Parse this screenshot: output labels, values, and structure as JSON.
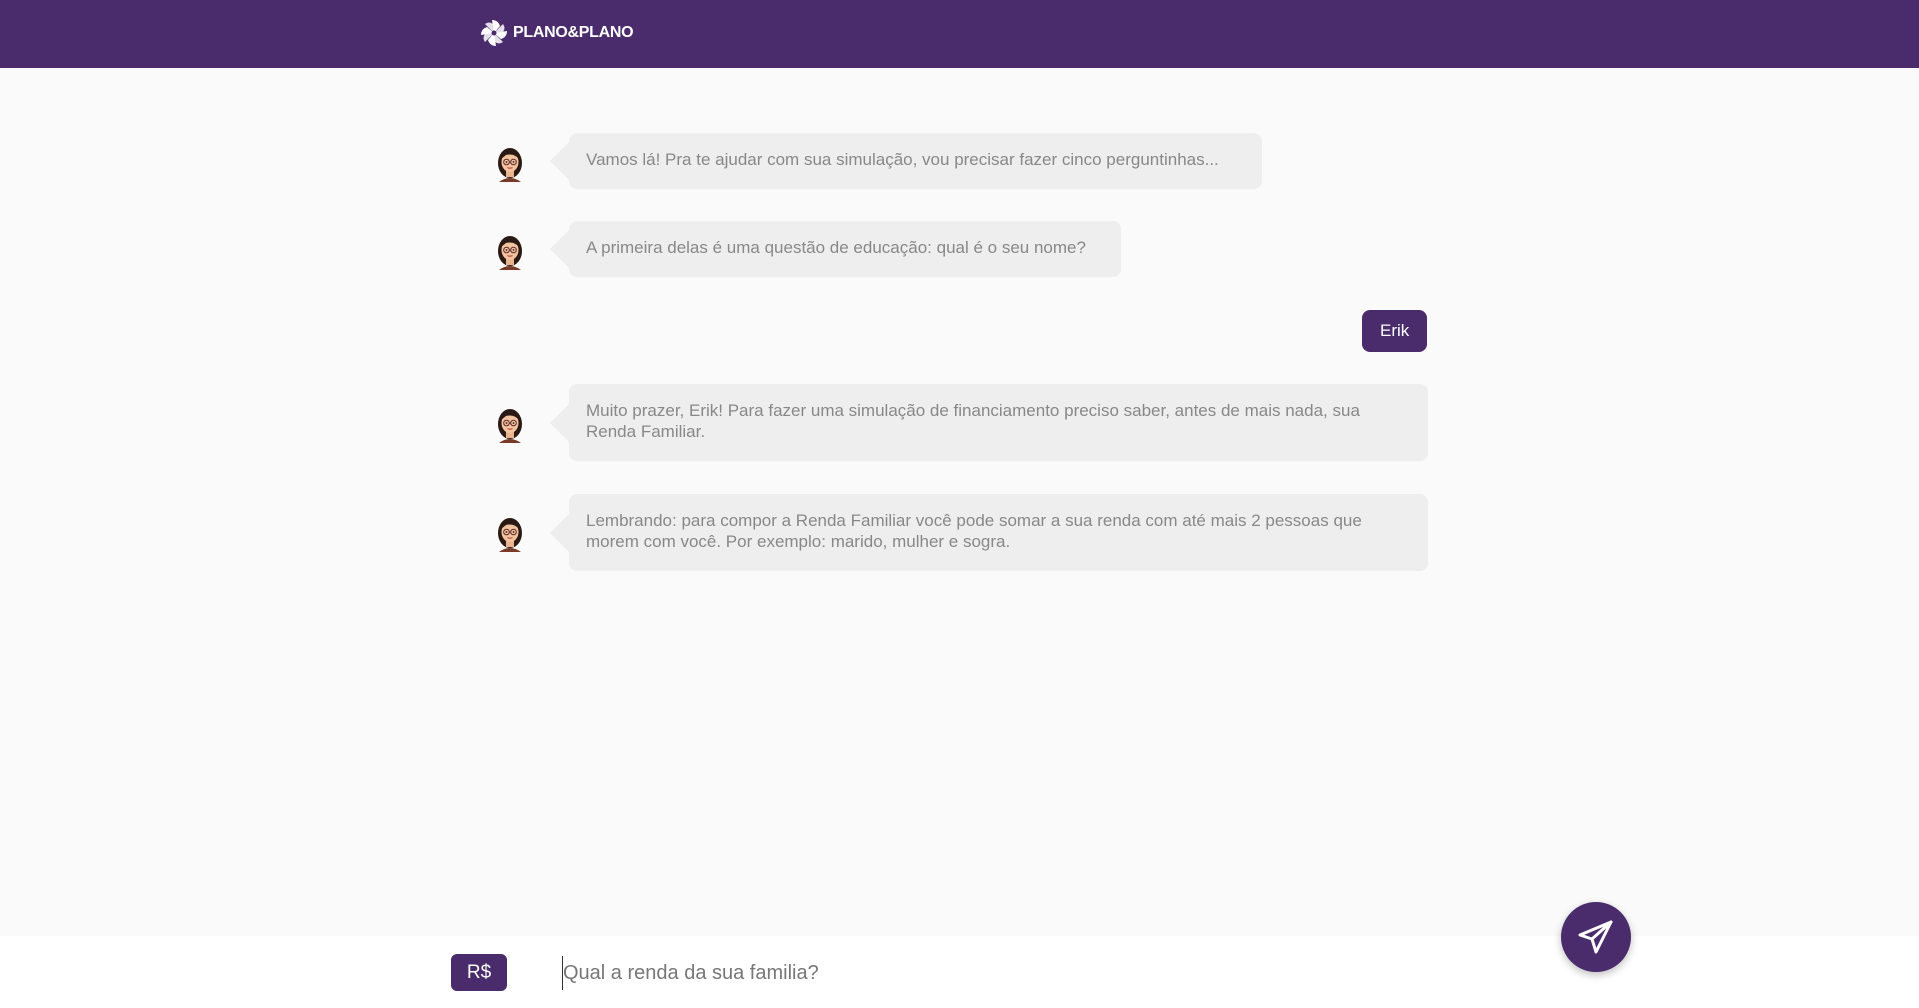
{
  "header": {
    "brand": "PLANO&PLANO",
    "logo_icon": "pinwheel-logo-icon"
  },
  "messages": [
    {
      "from": "bot",
      "text": "Vamos lá! Pra te ajudar com sua simulação, vou precisar fazer cinco perguntinhas..."
    },
    {
      "from": "bot",
      "text": "A primeira delas é uma questão de educação: qual é o seu nome?"
    },
    {
      "from": "user",
      "text": "Erik"
    },
    {
      "from": "bot",
      "text": "Muito prazer, Erik! Para fazer uma simulação de financiamento preciso saber, antes de mais nada, sua Renda Familiar."
    },
    {
      "from": "bot",
      "text": "Lembrando: para compor a Renda Familiar você pode somar a sua renda com até mais 2 pessoas que morem com você. Por exemplo: marido, mulher e sogra."
    }
  ],
  "bot_avatar": "woman-with-glasses-avatar-icon",
  "input": {
    "prefix": "R$",
    "value": "",
    "placeholder": "Qual a renda da sua familia?"
  },
  "send": {
    "icon": "paper-plane-icon"
  },
  "colors": {
    "brand": "#4a2b6b",
    "bot_bubble": "#eeeeee",
    "bot_text": "#888888",
    "background": "#fafafa"
  }
}
